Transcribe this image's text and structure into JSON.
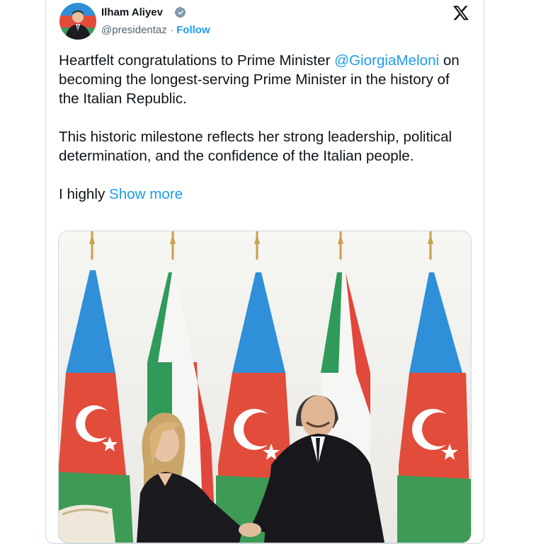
{
  "author": {
    "name": "Ilham Aliyev",
    "handle": "@presidentaz",
    "separator": " · ",
    "follow_label": "Follow",
    "verified_icon": "verified-badge-icon",
    "avatar_icon": "profile-photo"
  },
  "platform": {
    "logo_icon": "x-logo-icon"
  },
  "tweet": {
    "p1_start": "Heartfelt congratulations to Prime Minister ",
    "p1_mention": "@GiorgiaMeloni",
    "p1_end": " on becoming the longest-serving Prime Minister in the history of the Italian Republic.",
    "p2": "This historic milestone reflects her strong leadership, political determination, and the confidence of the Italian people.",
    "p3_start": "I highly ",
    "show_more_label": "Show more"
  },
  "media": {
    "photo_icon": "handshake-photo"
  },
  "colors": {
    "accent": "#1d9bf0",
    "text": "#0f1419",
    "muted": "#536471",
    "border": "#cfd9de",
    "az_blue": "#2f8fd8",
    "az_red": "#e24c3b",
    "az_green": "#3d9b55",
    "it_green": "#2f9a5a",
    "it_white": "#f6f6f4",
    "it_red": "#e2473c"
  }
}
